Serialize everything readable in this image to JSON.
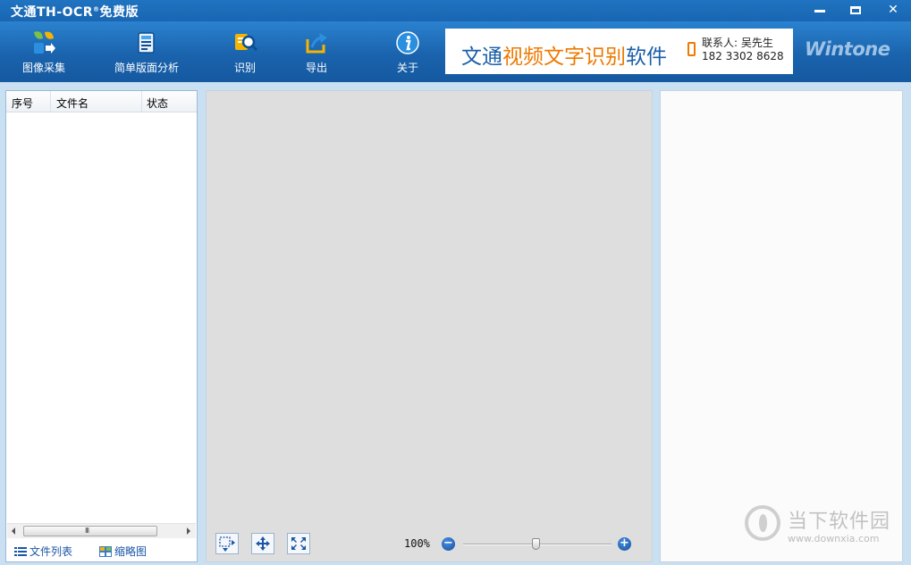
{
  "window": {
    "title": "文通TH-OCR",
    "title_reg": "®",
    "title_suffix": "免费版",
    "minimize_icon": "minimize-icon",
    "maximize_icon": "maximize-icon",
    "close_glyph": "✕"
  },
  "toolbar": {
    "items": [
      {
        "label": "图像采集",
        "icon": "image-capture-icon",
        "has_dropdown": true
      },
      {
        "label": "简单版面分析",
        "icon": "layout-analysis-icon",
        "has_dropdown": true
      },
      {
        "label": "识别",
        "icon": "recognize-icon",
        "has_dropdown": false
      },
      {
        "label": "导出",
        "icon": "export-icon",
        "has_dropdown": true
      },
      {
        "label": "关于",
        "icon": "info-icon",
        "has_dropdown": false
      }
    ]
  },
  "ad": {
    "part1": "文通",
    "part2": "视频文字识别",
    "part3": "软件",
    "contact_label": "联系人: 吴先生",
    "contact_phone": "182 3302 8628",
    "brand": "Wintone"
  },
  "file_list": {
    "columns": [
      "序号",
      "文件名",
      "状态"
    ],
    "rows": [],
    "scroll_grip": "III"
  },
  "bottom_tabs": {
    "list_view": "文件列表",
    "thumbnail_view": "缩略图"
  },
  "image_view": {
    "zoom_level": "100%",
    "zoom_minus": "−",
    "zoom_plus": "+",
    "zoom_fraction": 0.5,
    "tools": [
      "select-region-icon",
      "pan-icon",
      "fit-window-icon"
    ]
  },
  "watermark": {
    "text": "当下软件园",
    "url": "www.downxia.com"
  },
  "colors": {
    "title_bar": "#1f73c0",
    "toolbar": "#1a63ad",
    "accent_orange": "#ee7a00",
    "link_blue": "#1a56a6"
  }
}
